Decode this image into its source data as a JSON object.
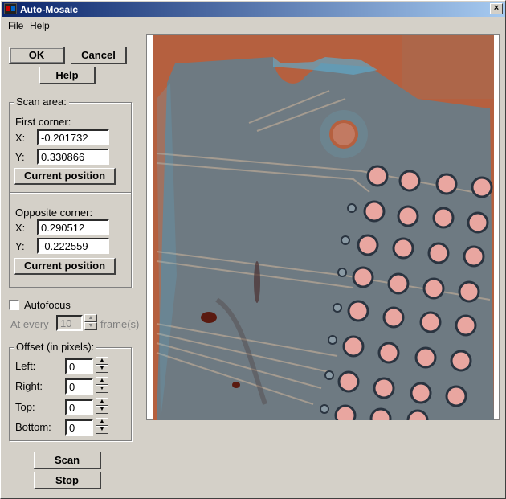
{
  "window": {
    "title": "Auto-Mosaic",
    "close_glyph": "×"
  },
  "menu": {
    "file": "File",
    "help": "Help"
  },
  "buttons": {
    "ok": "OK",
    "cancel": "Cancel",
    "help": "Help",
    "scan": "Scan",
    "stop": "Stop"
  },
  "scan_area": {
    "title": "Scan area:",
    "first_corner": {
      "label": "First corner:",
      "x_label": "X:",
      "x_value": "-0.201732",
      "y_label": "Y:",
      "y_value": "0.330866",
      "button": "Current position"
    },
    "opposite_corner": {
      "label": "Opposite corner:",
      "x_label": "X:",
      "x_value": "0.290512",
      "y_label": "Y:",
      "y_value": "-0.222559",
      "button": "Current position"
    }
  },
  "autofocus": {
    "label": "Autofocus",
    "checked": false,
    "at_every_label": "At every",
    "frames_value": "10",
    "frames_label": "frame(s)"
  },
  "offset": {
    "title": "Offset (in pixels):",
    "left_label": "Left:",
    "left_value": "0",
    "right_label": "Right:",
    "right_value": "0",
    "top_label": "Top:",
    "top_value": "0",
    "bottom_label": "Bottom:",
    "bottom_value": "0"
  },
  "icons": {
    "spin_up": "▲",
    "spin_down": "▼"
  },
  "colors": {
    "board_bg": "#b5603f",
    "board_gray": "#6e7a82",
    "pad_fill": "#e9a6a0",
    "pad_ring": "#2a3440",
    "trace": "#5a6870",
    "trace_hi": "#c8b09a"
  }
}
